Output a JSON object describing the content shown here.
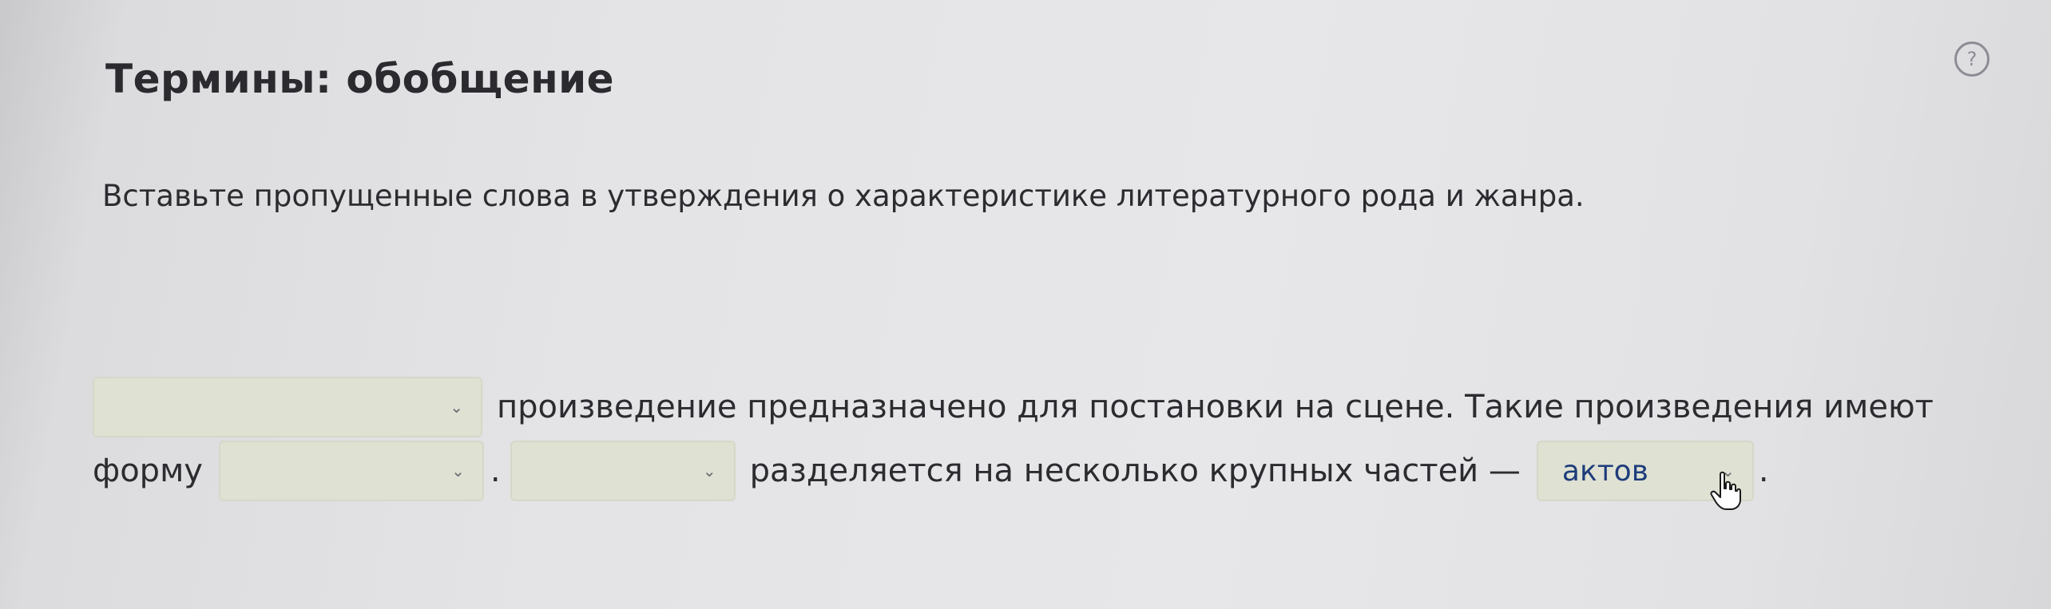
{
  "task": {
    "title": "Термины: обобщение",
    "instruction": "Вставьте пропущенные слова в утверждения о характеристике литературного рода и жанра."
  },
  "sentence": {
    "part1": "произведение предназначено для постановки на сцене. Такие произведения имеют",
    "part2": "форму",
    "part3": ".",
    "part4": "разделяется на несколько крупных частей —",
    "part5": "."
  },
  "selects": [
    {
      "selected": ""
    },
    {
      "selected": ""
    },
    {
      "selected": ""
    },
    {
      "selected": "актов"
    }
  ],
  "icons": {
    "help": "?",
    "dropdown": "⌄"
  }
}
